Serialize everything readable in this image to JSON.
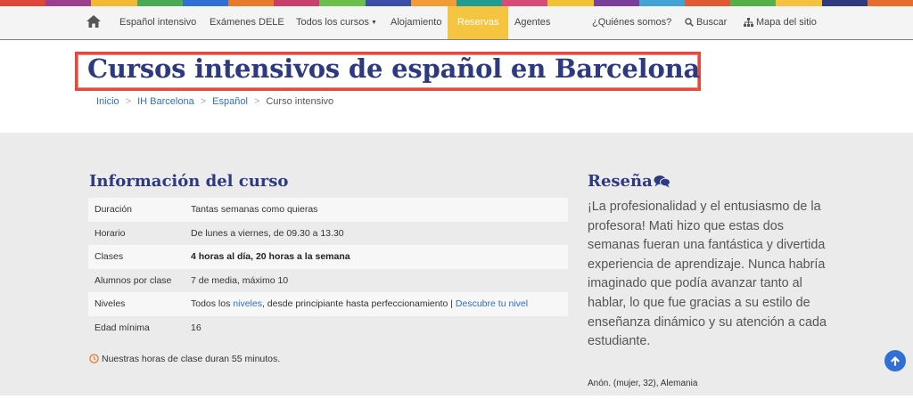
{
  "color_strip": [
    "#e2463a",
    "#9b3f8f",
    "#f2b935",
    "#4aab54",
    "#2f6fd6",
    "#e87a2c",
    "#c93f6b",
    "#6cbf4b",
    "#3c4fa8",
    "#f29c38",
    "#1f9b8f",
    "#d94b76",
    "#f2c232",
    "#7a3f9a",
    "#43a2d6",
    "#e25a31",
    "#55b04a",
    "#f6c040",
    "#2d3a80",
    "#ea6c2c"
  ],
  "nav": {
    "items": [
      "Español intensivo",
      "Exámenes DELE",
      "Todos los cursos",
      "Alojamiento",
      "Reservas",
      "Agentes",
      "¿Quiénes somos?",
      "Buscar",
      "Mapa del sitio"
    ],
    "active_color": "#f5c542"
  },
  "page_title": "Cursos intensivos de español en Barcelona",
  "breadcrumb": [
    "Inicio",
    "IH Barcelona",
    "Español",
    "Curso intensivo"
  ],
  "breadcrumb_sep": ">",
  "course_info": {
    "heading": "Información del curso",
    "rows": [
      {
        "label": "Duración",
        "value": "Tantas semanas como quieras"
      },
      {
        "label": "Horario",
        "value": "De lunes a viernes, de 09.30 a 13.30"
      },
      {
        "label": "Clases",
        "value": "4 horas al día, 20 horas a la semana"
      },
      {
        "label": "Alumnos por clase",
        "value": "7 de media, máximo 10"
      },
      {
        "label": "Niveles",
        "value_prefix": "Todos los ",
        "value_link": "niveles",
        "value_suffix": ", desde principiante hasta perfeccionamiento | ",
        "value_link2": "Descubre tu nivel"
      },
      {
        "label": "Edad mínima",
        "value": "16"
      }
    ],
    "note": "Nuestras horas de clase duran 55 minutos."
  },
  "review": {
    "heading": "Reseña",
    "text": "¡La profesionalidad y el entusiasmo de la profesora! Mati hizo que estas dos semanas fueran una fantástica y divertida experiencia de aprendizaje. Nunca habría imaginado que podía avanzar tanto al hablar, lo que fue gracias a su estilo de enseñanza dinámico y su atención a cada estudiante.",
    "author": "Anón. (mujer, 32), Alemania"
  },
  "colors": {
    "brand_navy": "#2d3a80",
    "link_blue": "#2f6fc1",
    "highlight_red": "#e34a3a",
    "section_gray": "#ebebeb"
  }
}
